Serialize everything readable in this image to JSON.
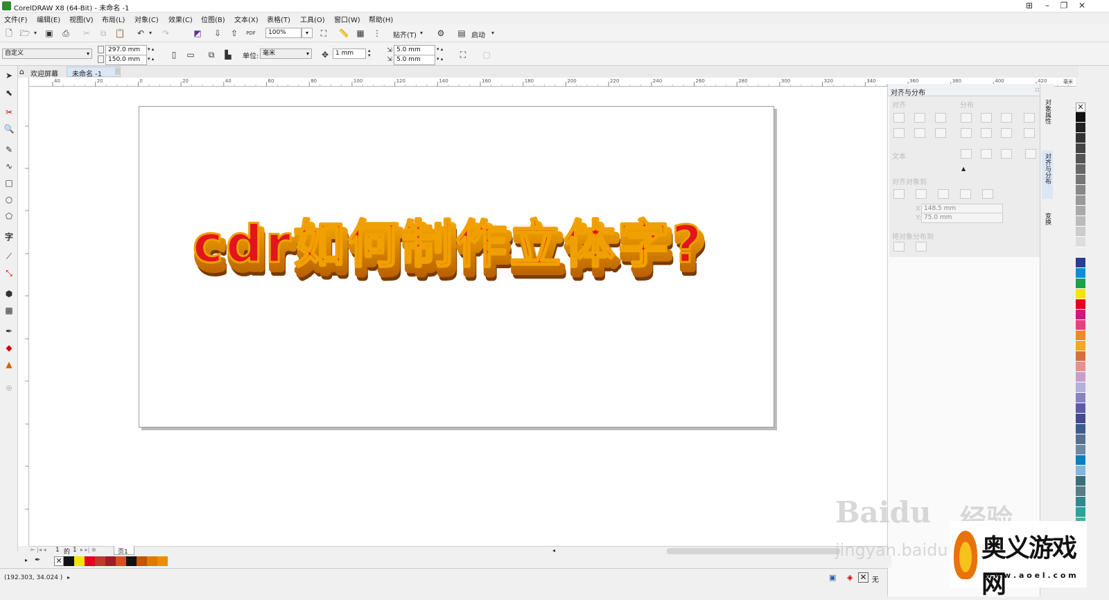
{
  "window": {
    "title": "CorelDRAW X8 (64-Bit) - 未命名 -1"
  },
  "menu": [
    "文件(F)",
    "编辑(E)",
    "视图(V)",
    "布局(L)",
    "对象(C)",
    "效果(C)",
    "位图(B)",
    "文本(X)",
    "表格(T)",
    "工具(O)",
    "窗口(W)",
    "帮助(H)"
  ],
  "toolbar": {
    "zoom": "100%",
    "snap_label": "贴齐(T)",
    "launch_label": "启动"
  },
  "propbar": {
    "preset": "自定义",
    "width": "297.0 mm",
    "height": "150.0 mm",
    "unit_label": "单位:",
    "unit_value": "毫米",
    "nudge": "1 mm",
    "dup_x": "5.0 mm",
    "dup_y": "5.0 mm"
  },
  "tabs": {
    "welcome": "欢迎屏幕",
    "doc": "未命名 -1"
  },
  "ruler_h": [
    "40",
    "20",
    "0",
    "20",
    "40",
    "60",
    "80",
    "100",
    "120",
    "140",
    "160",
    "180",
    "200",
    "220",
    "240",
    "260",
    "280",
    "300",
    "320",
    "340",
    "360",
    "380",
    "400",
    "420"
  ],
  "ruler_h_unit": "毫米",
  "canvas_text": "cdr如何制作立体字?",
  "docker": {
    "title": "对齐与分布",
    "section_align": "对齐",
    "section_distribute": "分布",
    "section_text": "文本",
    "align_objects_to": "对齐对象到",
    "x": "148.5 mm",
    "y": "75.0 mm",
    "x_label": "X:",
    "y_label": "Y:",
    "distribute_to": "将对象分布到"
  },
  "docker_tabs": [
    "对象属性",
    "对齐与分布",
    "变换"
  ],
  "page_nav": {
    "current": "1",
    "of": "的",
    "total": "1",
    "page_tab": "页1"
  },
  "status": {
    "coords": "(192.303, 34.024 )",
    "fill_none": "无"
  },
  "palette_colors": [
    "#111111",
    "#222222",
    "#333333",
    "#444444",
    "#555555",
    "#666666",
    "#777777",
    "#888888",
    "#999999",
    "#aaaaaa",
    "#bbbbbb",
    "#cccccc",
    "#dddddd",
    "#eeeeee",
    "#2b3c94",
    "#0a8fd6",
    "#17a34a",
    "#f5e400",
    "#e6001e",
    "#d4177a",
    "#e8417f",
    "#f08a24",
    "#f5a623",
    "#d96f3b",
    "#e88f8f",
    "#c7a0c9",
    "#b3b0d9",
    "#8a83c2",
    "#5d5aa8",
    "#434b8c",
    "#3c5b8f",
    "#56718f",
    "#6c8aa4",
    "#0c7fc1",
    "#84b6d8",
    "#3a6f7a",
    "#587d86",
    "#2f8a8f",
    "#2aa39a",
    "#49b394",
    "#7fc0a3"
  ],
  "doc_palette_colors": [
    "#111111",
    "#f5e400",
    "#e6001e",
    "#c0392b",
    "#a01c2a",
    "#d6501c",
    "#111111",
    "#c45500",
    "#e07b00",
    "#f08c00"
  ],
  "watermark": {
    "baidu": "Baidu",
    "jingyan": "经验",
    "url": "jingyan.baidu.com",
    "site": "奥义游戏网",
    "site_url": "w w w . a o e l . c o m"
  }
}
